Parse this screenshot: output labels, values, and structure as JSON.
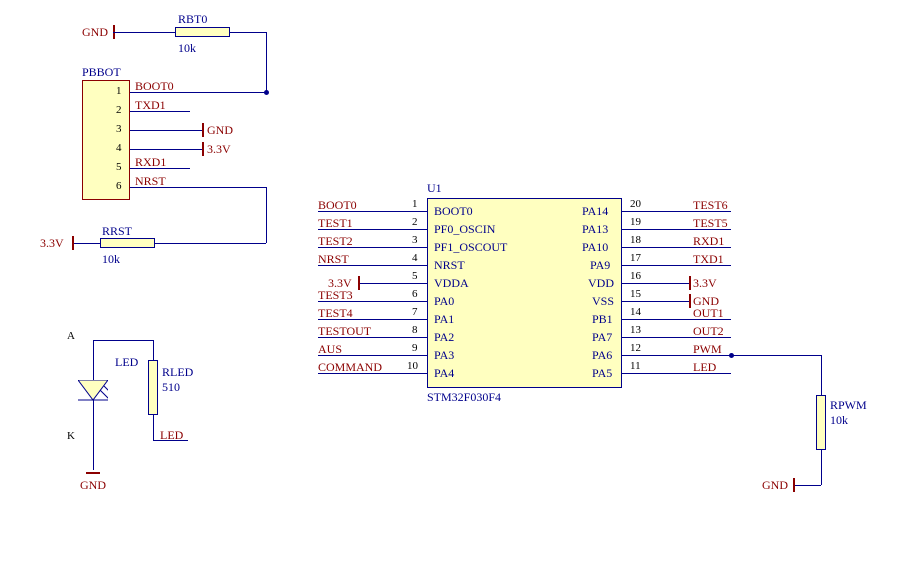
{
  "rbt0": {
    "name": "RBT0",
    "value": "10k"
  },
  "rrst": {
    "name": "RRST",
    "value": "10k"
  },
  "rled": {
    "name": "RLED",
    "value": "510"
  },
  "rpwm": {
    "name": "RPWM",
    "value": "10k"
  },
  "pbbot": {
    "name": "PBBOT",
    "pins": [
      "1",
      "2",
      "3",
      "4",
      "5",
      "6"
    ],
    "nets": [
      "BOOT0",
      "TXD1",
      "",
      "",
      "RXD1",
      "NRST"
    ],
    "gnd": "GND",
    "v33": "3.3V"
  },
  "power": {
    "gnd": "GND",
    "v33": "3.3V"
  },
  "led": {
    "name": "LED",
    "a": "A",
    "k": "K",
    "net": "LED"
  },
  "u1": {
    "ref": "U1",
    "part": "STM32F030F4",
    "left": [
      {
        "n": "1",
        "name": "BOOT0",
        "net": "BOOT0"
      },
      {
        "n": "2",
        "name": "PF0_OSCIN",
        "net": "TEST1"
      },
      {
        "n": "3",
        "name": "PF1_OSCOUT",
        "net": "TEST2"
      },
      {
        "n": "4",
        "name": "NRST",
        "net": "NRST"
      },
      {
        "n": "5",
        "name": "VDDA",
        "net": "3.3V",
        "isPower": true
      },
      {
        "n": "6",
        "name": "PA0",
        "net": "TEST3"
      },
      {
        "n": "7",
        "name": "PA1",
        "net": "TEST4"
      },
      {
        "n": "8",
        "name": "PA2",
        "net": "TESTOUT"
      },
      {
        "n": "9",
        "name": "PA3",
        "net": "AUS"
      },
      {
        "n": "10",
        "name": "PA4",
        "net": "COMMAND"
      }
    ],
    "right": [
      {
        "n": "20",
        "name": "PA14",
        "net": "TEST6"
      },
      {
        "n": "19",
        "name": "PA13",
        "net": "TEST5"
      },
      {
        "n": "18",
        "name": "PA10",
        "net": "RXD1"
      },
      {
        "n": "17",
        "name": "PA9",
        "net": "TXD1"
      },
      {
        "n": "16",
        "name": "VDD",
        "net": "3.3V",
        "isPower": true
      },
      {
        "n": "15",
        "name": "VSS",
        "net": "GND",
        "isPower": true
      },
      {
        "n": "14",
        "name": "PB1",
        "net": "OUT1"
      },
      {
        "n": "13",
        "name": "PA7",
        "net": "OUT2"
      },
      {
        "n": "12",
        "name": "PA6",
        "net": "PWM"
      },
      {
        "n": "11",
        "name": "PA5",
        "net": "LED"
      }
    ]
  }
}
